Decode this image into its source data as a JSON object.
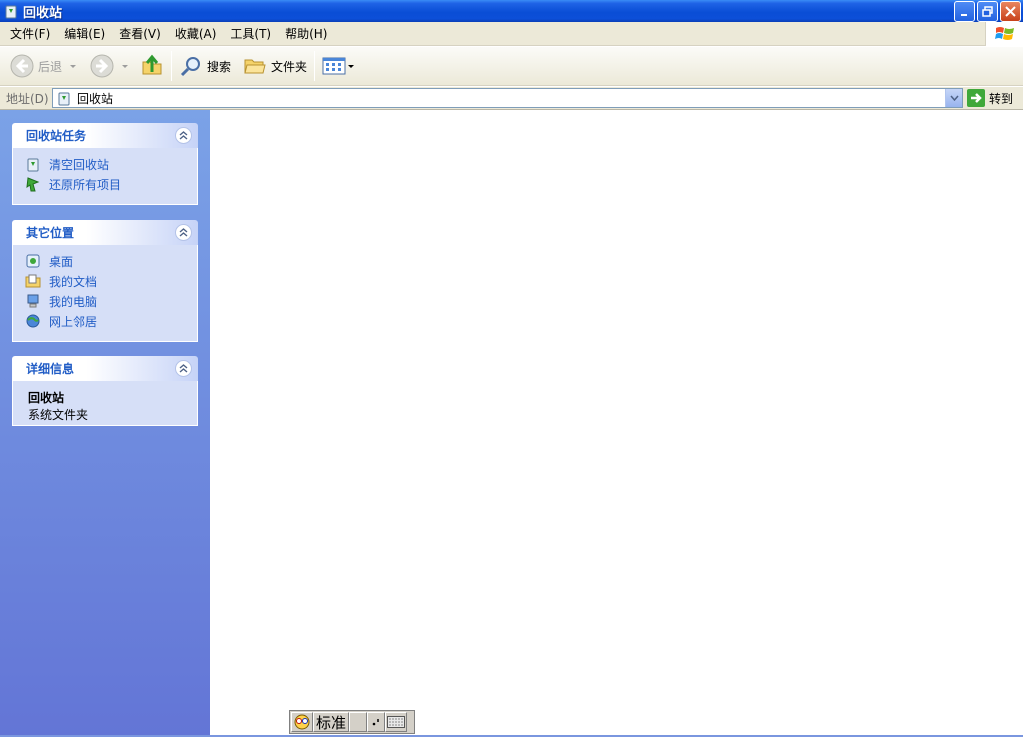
{
  "window": {
    "title": "回收站"
  },
  "menubar": {
    "items": [
      {
        "label": "文件(F)"
      },
      {
        "label": "编辑(E)"
      },
      {
        "label": "查看(V)"
      },
      {
        "label": "收藏(A)"
      },
      {
        "label": "工具(T)"
      },
      {
        "label": "帮助(H)"
      }
    ]
  },
  "toolbar": {
    "back_label": "后退",
    "search_label": "搜索",
    "folders_label": "文件夹"
  },
  "address": {
    "label": "地址(D)",
    "value": "回收站",
    "go_label": "转到"
  },
  "taskpane": {
    "recycle_tasks": {
      "title": "回收站任务",
      "items": [
        {
          "label": "清空回收站",
          "icon": "empty-recycle-bin-icon"
        },
        {
          "label": "还原所有项目",
          "icon": "restore-icon"
        }
      ]
    },
    "other_places": {
      "title": "其它位置",
      "items": [
        {
          "label": "桌面",
          "icon": "desktop-icon"
        },
        {
          "label": "我的文档",
          "icon": "my-documents-icon"
        },
        {
          "label": "我的电脑",
          "icon": "my-computer-icon"
        },
        {
          "label": "网上邻居",
          "icon": "network-icon"
        }
      ]
    },
    "details": {
      "title": "详细信息",
      "name": "回收站",
      "type": "系统文件夹"
    }
  },
  "ime": {
    "mode": "标准"
  },
  "colors": {
    "titlebar": "#0a4ed6",
    "task_link": "#215dc6",
    "pane_top": "#7ba2e7",
    "pane_bottom": "#6375d6"
  }
}
